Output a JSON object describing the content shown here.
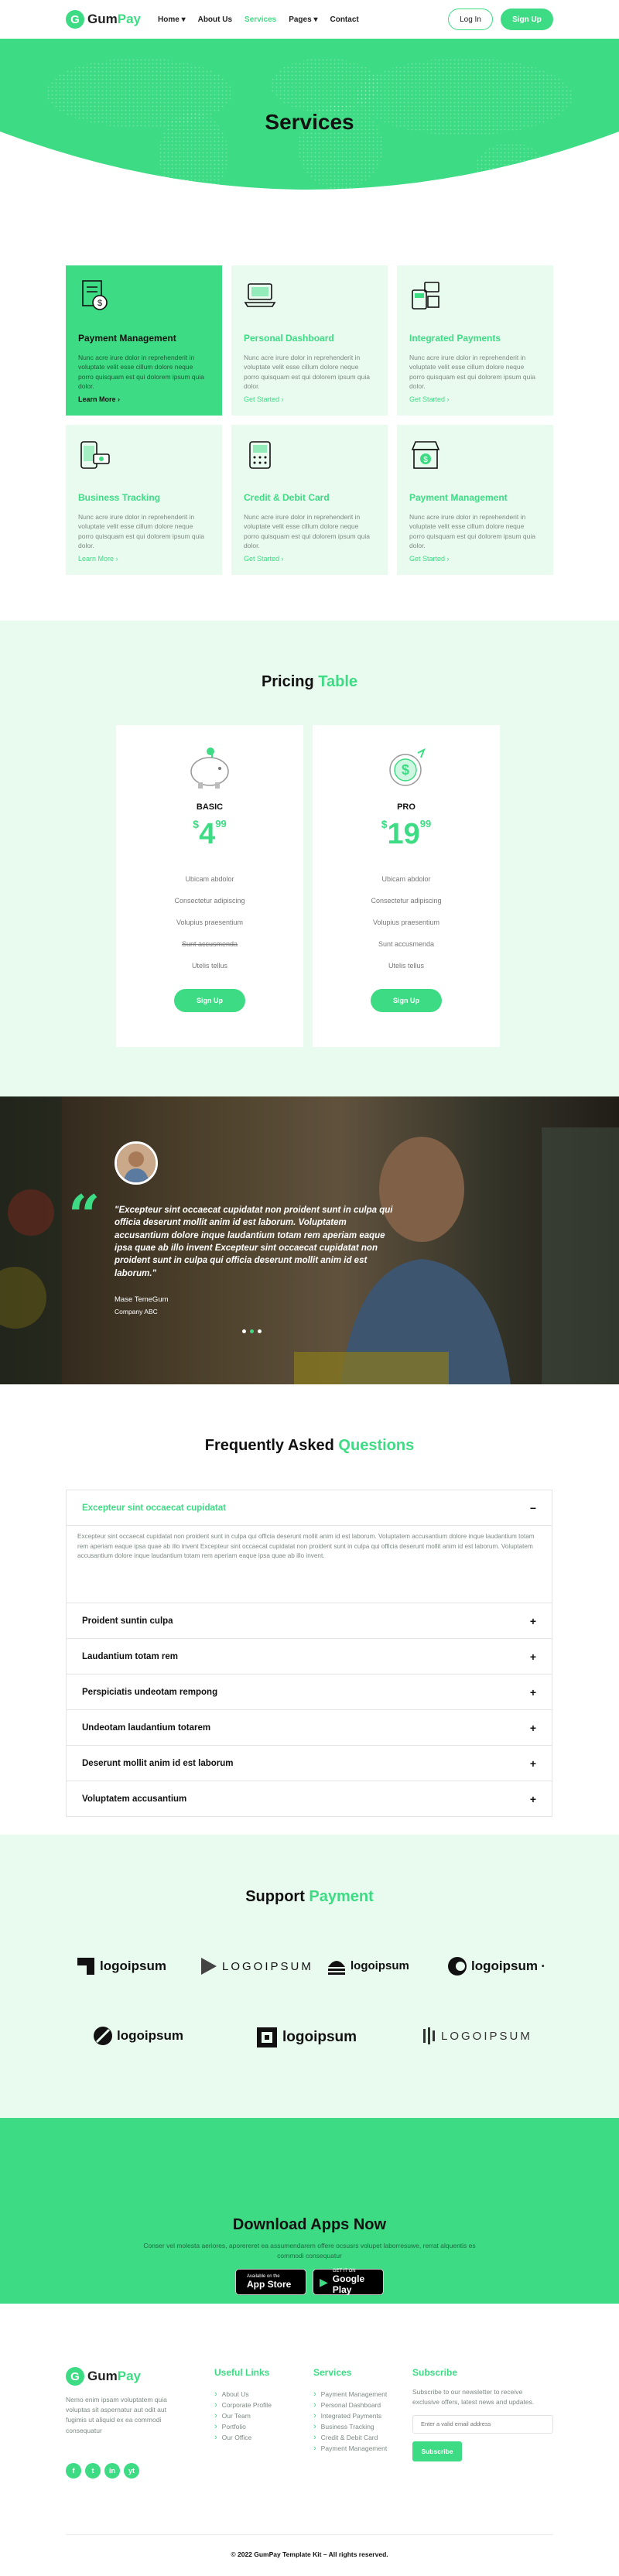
{
  "brand": {
    "logo_letter": "G",
    "name_part1": "Gum",
    "name_part2": "Pay"
  },
  "colors": {
    "accent": "#3ddc84",
    "light_bg": "#e9faef",
    "text_dark": "#111111"
  },
  "nav": {
    "items": [
      {
        "label": "Home",
        "has_dropdown": true
      },
      {
        "label": "About Us",
        "has_dropdown": false
      },
      {
        "label": "Services",
        "has_dropdown": false,
        "active": true
      },
      {
        "label": "Pages",
        "has_dropdown": true
      },
      {
        "label": "Contact",
        "has_dropdown": false
      }
    ],
    "login_label": "Log In",
    "signup_label": "Sign Up"
  },
  "hero": {
    "title": "Services"
  },
  "services": [
    {
      "title": "Payment Management",
      "text": "Nunc acre irure dolor in reprehenderit in voluptate velit esse cillum dolore neque porro quisquam est qui dolorem ipsum quia dolor.",
      "link": "Learn More",
      "icon": "document-icon"
    },
    {
      "title": "Personal Dashboard",
      "text": "Nunc acre irure dolor in reprehenderit in voluptate velit esse cillum dolore neque porro quisquam est qui dolorem ipsum quia dolor.",
      "link": "Get Started",
      "icon": "laptop-icon"
    },
    {
      "title": "Integrated Payments",
      "text": "Nunc acre irure dolor in reprehenderit in voluptate velit esse cillum dolore neque porro quisquam est qui dolorem ipsum quia dolor.",
      "link": "Get Started",
      "icon": "pos-terminal-icon"
    },
    {
      "title": "Business Tracking",
      "text": "Nunc acre irure dolor in reprehenderit in voluptate velit esse cillum dolore neque porro quisquam est qui dolorem ipsum quia dolor.",
      "link": "Learn More",
      "icon": "phone-money-icon"
    },
    {
      "title": "Credit & Debit Card",
      "text": "Nunc acre irure dolor in reprehenderit in voluptate velit esse cillum dolore neque porro quisquam est qui dolorem ipsum quia dolor.",
      "link": "Get Started",
      "icon": "card-terminal-icon"
    },
    {
      "title": "Payment Management",
      "text": "Nunc acre irure dolor in reprehenderit in voluptate velit esse cillum dolore neque porro quisquam est qui dolorem ipsum quia dolor.",
      "link": "Get Started",
      "icon": "store-icon"
    }
  ],
  "pricing": {
    "title_part1": "Pricing",
    "title_part2": "Table",
    "plans": [
      {
        "name": "BASIC",
        "currency": "$",
        "amount": "4",
        "cents": "99",
        "icon": "piggy-bank-icon",
        "features": [
          {
            "text": "Ubicam abdolor",
            "strike": false
          },
          {
            "text": "Consectetur adipiscing",
            "strike": false
          },
          {
            "text": "Volupius praesentium",
            "strike": false
          },
          {
            "text": "Sunt accusmenda",
            "strike": true
          },
          {
            "text": "Utelis tellus",
            "strike": false
          }
        ],
        "button": "Sign Up"
      },
      {
        "name": "PRO",
        "currency": "$",
        "amount": "19",
        "cents": "99",
        "icon": "coin-stack-icon",
        "features": [
          {
            "text": "Ubicam abdolor",
            "strike": false
          },
          {
            "text": "Consectetur adipiscing",
            "strike": false
          },
          {
            "text": "Volupius praesentium",
            "strike": false
          },
          {
            "text": "Sunt accusmenda",
            "strike": false
          },
          {
            "text": "Utelis tellus",
            "strike": false
          }
        ],
        "button": "Sign Up"
      }
    ]
  },
  "testimonial": {
    "quote": "\"Excepteur sint occaecat cupidatat non proident sunt in culpa qui officia deserunt mollit anim id est laborum. Voluptatem accusantium dolore inque laudantium totam rem aperiam eaque ipsa quae ab illo invent Excepteur sint occaecat cupidatat non proident sunt in culpa qui officia deserunt mollit anim id est laborum.\"",
    "name": "Mase TemeGum",
    "company": "Company ABC",
    "dots": 3,
    "active_dot": 1
  },
  "faq": {
    "title_part1": "Frequently Asked",
    "title_part2": "Questions",
    "open": {
      "question": "Excepteur sint occaecat cupidatat",
      "answer": "Excepteur sint occaecat cupidatat non proident sunt in culpa qui officia deserunt mollit anim id est laborum. Voluptatem accusantium dolore inque laudantium totam rem aperiam eaque ipsa quae ab illo invent Excepteur sint occaecat cupidatat non proident sunt in culpa qui officia deserunt mollit anim id est laborum. Voluptatem accusantium dolore inque laudantium totam rem aperiam eaque ipsa quae ab illo invent.",
      "sign": "−"
    },
    "items": [
      {
        "question": "Proident suntin culpa",
        "sign": "+"
      },
      {
        "question": "Laudantium totam rem",
        "sign": "+"
      },
      {
        "question": "Perspiciatis undeotam rempong",
        "sign": "+"
      },
      {
        "question": "Undeotam laudantium totarem",
        "sign": "+"
      },
      {
        "question": "Deserunt mollit anim id est laborum",
        "sign": "+"
      },
      {
        "question": "Voluptatem accusantium",
        "sign": "+"
      }
    ]
  },
  "support": {
    "title_part1": "Support",
    "title_part2": "Payment",
    "logos": [
      {
        "text": "logoipsum",
        "style": "bold"
      },
      {
        "text": "LOGOIPSUM",
        "style": "spaced"
      },
      {
        "text": "logoipsum",
        "style": "bold"
      },
      {
        "text": "logoipsum",
        "style": "bold-dot"
      },
      {
        "text": "logoipsum",
        "style": "bold"
      },
      {
        "text": "logoipsum",
        "style": "bold"
      },
      {
        "text": "LOGOIPSUM",
        "style": "spaced"
      }
    ]
  },
  "download": {
    "title": "Download Apps Now",
    "text": "Conser vel molesta aeriores, aporereret ea assumendarem offere ocsusrs volupet laborresuwe, rerrat alquentis es commodi consequatur",
    "app_store_small": "Available on the",
    "app_store_big": "App Store",
    "google_small": "GET IT ON",
    "google_big": "Google Play"
  },
  "footer": {
    "about": "Nemo enim ipsam voluptatem quia voluptas sit aspernatur aut odit aut fugimis ut aliquid ex ea commodi consequatur",
    "social": [
      "f",
      "t",
      "in",
      "yt"
    ],
    "useful_links": {
      "title": "Useful Links",
      "items": [
        "About Us",
        "Corporate Profile",
        "Our Team",
        "Portfolio",
        "Our Office"
      ]
    },
    "services": {
      "title": "Services",
      "items": [
        "Payment Management",
        "Personal Dashboard",
        "Integrated Payments",
        "Business Tracking",
        "Credit & Debit Card",
        "Payment Management"
      ]
    },
    "subscribe": {
      "title": "Subscribe",
      "text": "Subscribe to our newsletter to receive exclusive offers, latest news and updates.",
      "placeholder": "Enter a valid email address",
      "button": "Subscribe"
    },
    "copyright": "© 2022 GumPay Template Kit – All rights reserved."
  }
}
